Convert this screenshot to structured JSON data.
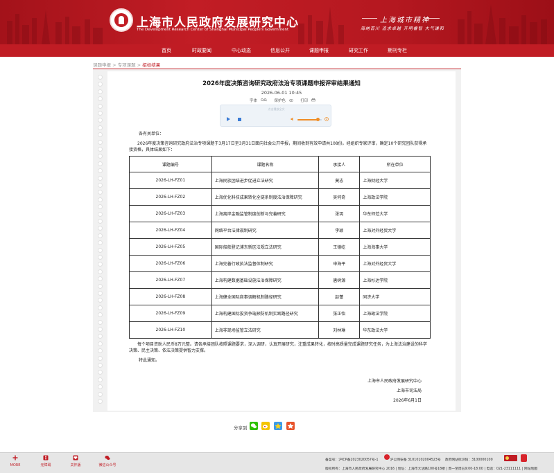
{
  "header": {
    "site_title": "上海市人民政府发展研究中心",
    "site_subtitle": "The Development Research Center of Shanghai Municipal People's Government",
    "motto_title": "上海城市精神",
    "motto_text": "海纳百川  追求卓越  开明睿智  大气谦和",
    "brand_color": "#c01c24"
  },
  "nav": {
    "items": [
      "首页",
      "时政要闻",
      "中心动态",
      "信息公开",
      "课题申报",
      "研究工作",
      "期刊专栏"
    ]
  },
  "breadcrumb": {
    "item1": "课题申报",
    "sep1": " > ",
    "item2": "专项课题",
    "sep2": " > ",
    "current": "招标结果"
  },
  "article": {
    "title": "2026年度决策咨询研究政府法治专项课题申报评审结果通知",
    "date": "2026-06-01 10:45",
    "tools": {
      "font": "字体",
      "font_icon": "magnify-icon",
      "eye_care": "保护色",
      "print": "打印"
    },
    "player_hint": "点击播放全文",
    "greeting": "各有关单位：",
    "intro": "2026年度决策咨询研究政府法治专项课题于3月17日至3月31日面向社会公开申报，期间收到有效申请共108份。经组织专家评审，确定10个研究团队获得承接资格，具体结果如下：",
    "table": {
      "headers": [
        "课题编号",
        "课题名称",
        "承接人",
        "所在单位"
      ],
      "rows": [
        [
          "2026-LH-FZ01",
          "上海民族团结进步促进立法研究",
          "莫志",
          "上海财经大学"
        ],
        [
          "2026-LH-FZ02",
          "上海优化科技成果转化全链条制度法治保障研究",
          "吴何奇",
          "上海政法学院"
        ],
        [
          "2026-LH-FZ03",
          "上海离岸金融监管制度创新与完善研究",
          "张玥",
          "华东师范大学"
        ],
        [
          "2026-LH-FZ04",
          "网络平台法律规制研究",
          "李颖",
          "上海对外经贸大学"
        ],
        [
          "2026-LH-FZ05",
          "国际船舶登记浦东新区法规立法研究",
          "王德屹",
          "上海海事大学"
        ],
        [
          "2026-LH-FZ06",
          "上海完善行政执法监督体制研究",
          "申海平",
          "上海对外经贸大学"
        ],
        [
          "2026-LH-FZ07",
          "上海构建数据基础设施法治保障研究",
          "唐树源",
          "上海杉达学院"
        ],
        [
          "2026-LH-FZ08",
          "上海健全国际商事调解机制路径研究",
          "赵蕾",
          "同济大学"
        ],
        [
          "2026-LH-FZ09",
          "上海构建国际投资争端预防机制实践路径研究",
          "张正怡",
          "上海政法学院"
        ],
        [
          "2026-LH-FZ10",
          "上海非现场监管立法研究",
          "刘林琳",
          "华东政法大学"
        ]
      ]
    },
    "closing": "每个项目资助人民币8万元整。请各承接团队按照课题要求，深入调研，认真开展研究，注重成果转化，按时高质量完成课题研究任务，为上海法治建设的科学决策、民主决策、依法决策提供智力支撑。",
    "special": "特此通知。",
    "signer1": "上海市人民政府发展研究中心",
    "signer2": "上海市司法局",
    "sign_date": "2026年6月1日"
  },
  "share": {
    "label": "分享到",
    "icons": [
      "wechat-icon",
      "weibo-icon",
      "qzone-icon",
      "favorite-icon"
    ]
  },
  "footer": {
    "tools": [
      "MORE",
      "无障碍",
      "关怀版",
      "微信公众号"
    ],
    "icp_label": "备案号：",
    "icp": "沪ICP备2023020057号-1",
    "police": "沪公网安备 31010102004523号",
    "gov_code": "政府网站标识码：3100000100",
    "copyright": "版权所有：上海市人民政府发展研究中心 2016",
    "address": "地址：上海市大沽路100号18楼",
    "hours": "周一至周五9:00-18:00",
    "phone": "电话：021-23111111",
    "sitemap": "网站地图"
  }
}
